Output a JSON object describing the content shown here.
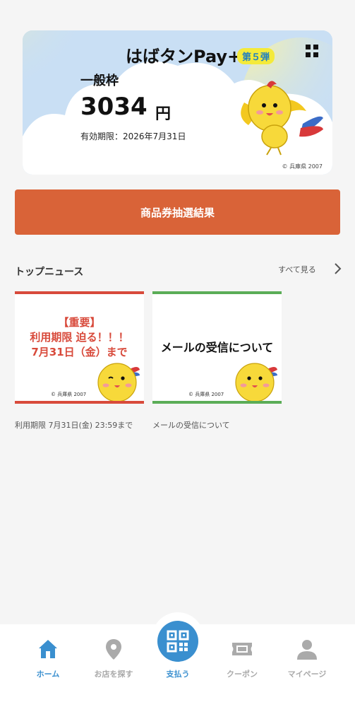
{
  "card": {
    "brand_title": "はばタンPay+",
    "badge": "第５弾",
    "limit_label": "一般枠",
    "amount": "3034",
    "unit": "円",
    "expiry": "有効期限：2026年7月31日",
    "copyright": "© 兵庫県 2007"
  },
  "lottery_button": "商品券抽選結果",
  "news": {
    "title": "トップニュース",
    "see_all": "すべて見る",
    "items": [
      {
        "headline_lines": [
          "【重要】",
          "利用期限 迫る！！！",
          "7月31日（金）まで"
        ],
        "copyright": "© 兵庫県 2007",
        "caption": "利用期限 7月31日(金) 23:59まで",
        "accent": "#d84a3b"
      },
      {
        "headline": "メールの受信について",
        "copyright": "© 兵庫県 2007",
        "caption": "メールの受信について",
        "accent": "#5bad57"
      }
    ]
  },
  "nav": {
    "items": [
      {
        "label": "ホーム",
        "icon": "home-icon",
        "active": true
      },
      {
        "label": "お店を探す",
        "icon": "location-pin-icon",
        "active": false
      },
      {
        "label": "支払う",
        "icon": "qr-code-icon",
        "active": true
      },
      {
        "label": "クーポン",
        "icon": "ticket-icon",
        "active": false
      },
      {
        "label": "マイページ",
        "icon": "person-icon",
        "active": false
      }
    ]
  },
  "colors": {
    "primary": "#3a8fcf",
    "orange": "#d96338",
    "red": "#d84a3b",
    "green": "#5bad57",
    "card_bg": "#c9dff4",
    "yellow": "#f4ea3a"
  }
}
